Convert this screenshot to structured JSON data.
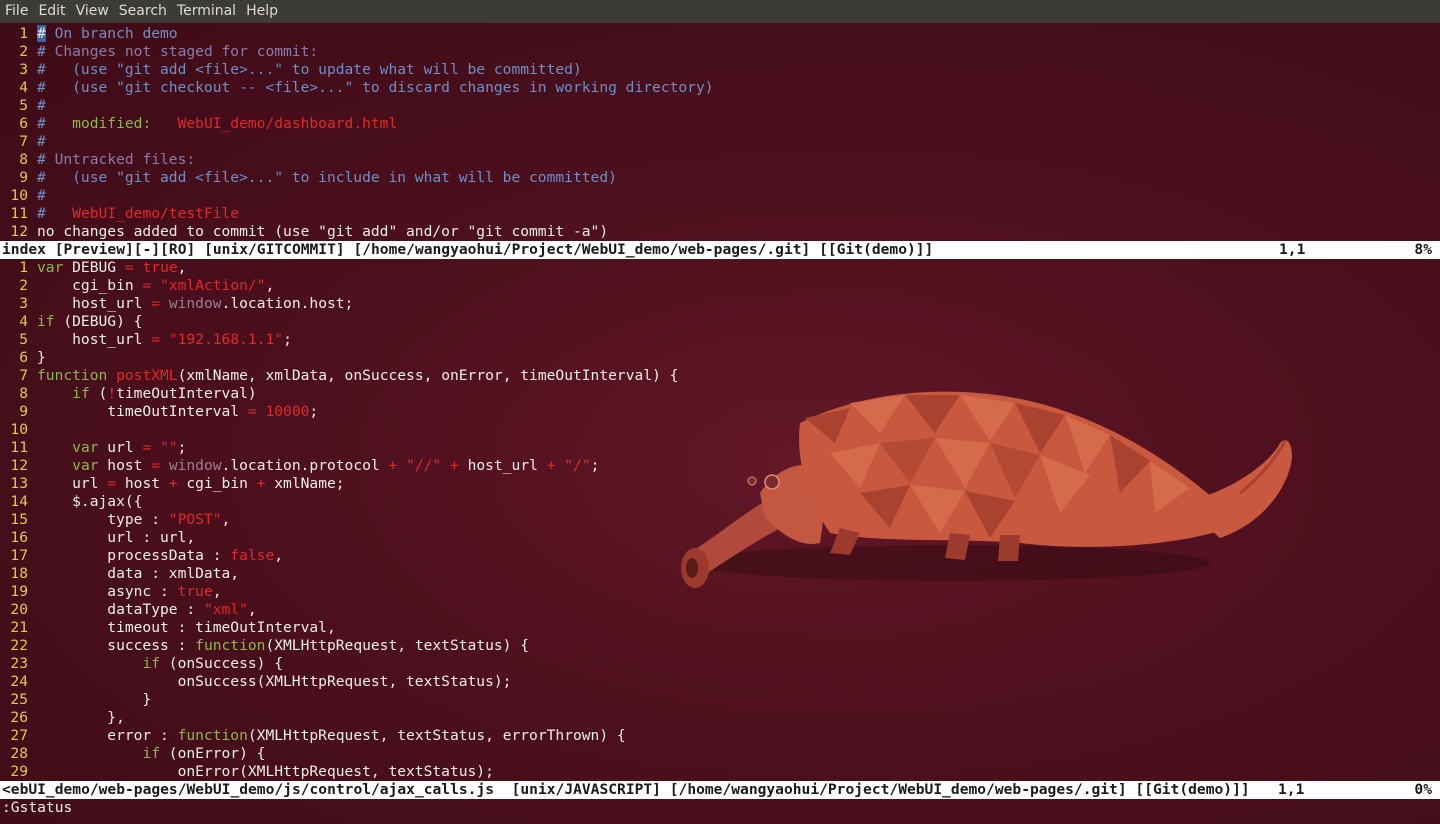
{
  "menubar": {
    "items": [
      "File",
      "Edit",
      "View",
      "Search",
      "Terminal",
      "Help"
    ]
  },
  "top_pane": {
    "lines": [
      {
        "n": "1",
        "parts": [
          [
            "cursor",
            "#"
          ],
          [
            "c-comment",
            " On branch demo"
          ]
        ]
      },
      {
        "n": "2",
        "parts": [
          [
            "c-comment",
            "# "
          ],
          [
            "c-header",
            "Changes not staged for commit:"
          ]
        ]
      },
      {
        "n": "3",
        "parts": [
          [
            "c-comment",
            "#   (use \"git add <file>...\" to update what will be committed)"
          ]
        ]
      },
      {
        "n": "4",
        "parts": [
          [
            "c-comment",
            "#   (use \"git checkout -- <file>...\" to discard changes in working directory)"
          ]
        ]
      },
      {
        "n": "5",
        "parts": [
          [
            "c-comment",
            "#"
          ]
        ]
      },
      {
        "n": "6",
        "parts": [
          [
            "c-comment",
            "#   "
          ],
          [
            "c-mod",
            "modified:"
          ],
          [
            "c-comment",
            "   "
          ],
          [
            "c-file",
            "WebUI_demo/dashboard.html"
          ]
        ]
      },
      {
        "n": "7",
        "parts": [
          [
            "c-comment",
            "#"
          ]
        ]
      },
      {
        "n": "8",
        "parts": [
          [
            "c-comment",
            "# "
          ],
          [
            "c-header",
            "Untracked files:"
          ]
        ]
      },
      {
        "n": "9",
        "parts": [
          [
            "c-comment",
            "#   (use \"git add <file>...\" to include in what will be committed)"
          ]
        ]
      },
      {
        "n": "10",
        "parts": [
          [
            "c-comment",
            "#"
          ]
        ]
      },
      {
        "n": "11",
        "parts": [
          [
            "c-comment",
            "#   "
          ],
          [
            "c-file",
            "WebUI_demo/testFile"
          ]
        ]
      },
      {
        "n": "12",
        "parts": [
          [
            "code",
            "no changes added to commit (use \"git add\" and/or \"git commit -a\")"
          ]
        ]
      }
    ],
    "status": {
      "left": "index [Preview][-][RO] [unix/GITCOMMIT] [/home/wangyaohui/Project/WebUI_demo/web-pages/.git] [[Git(demo)]]",
      "pos": "1,1",
      "pct": "8%"
    }
  },
  "bottom_pane": {
    "lines": [
      {
        "n": "1",
        "parts": [
          [
            "c-kw",
            "var"
          ],
          [
            "code",
            " DEBUG "
          ],
          [
            "c-op",
            "="
          ],
          [
            "code",
            " "
          ],
          [
            "c-str",
            "true"
          ],
          [
            "code",
            ","
          ]
        ]
      },
      {
        "n": "2",
        "parts": [
          [
            "code",
            "    cgi_bin "
          ],
          [
            "c-op",
            "="
          ],
          [
            "code",
            " "
          ],
          [
            "c-str",
            "\"xmlAction/\""
          ],
          [
            "code",
            ","
          ]
        ]
      },
      {
        "n": "3",
        "parts": [
          [
            "code",
            "    host_url "
          ],
          [
            "c-op",
            "="
          ],
          [
            "code",
            " "
          ],
          [
            "c-win",
            "window"
          ],
          [
            "code",
            ".location.host;"
          ]
        ]
      },
      {
        "n": "4",
        "parts": [
          [
            "c-kw",
            "if"
          ],
          [
            "code",
            " (DEBUG) {"
          ]
        ]
      },
      {
        "n": "5",
        "parts": [
          [
            "code",
            "    host_url "
          ],
          [
            "c-op",
            "="
          ],
          [
            "code",
            " "
          ],
          [
            "c-str",
            "\"192.168.1.1\""
          ],
          [
            "code",
            ";"
          ]
        ]
      },
      {
        "n": "6",
        "parts": [
          [
            "code",
            "}"
          ]
        ]
      },
      {
        "n": "7",
        "parts": [
          [
            "c-kw",
            "function"
          ],
          [
            "code",
            " "
          ],
          [
            "c-fn",
            "postXML"
          ],
          [
            "code",
            "(xmlName, xmlData, onSuccess, onError, timeOutInterval) {"
          ]
        ]
      },
      {
        "n": "8",
        "parts": [
          [
            "code",
            "    "
          ],
          [
            "c-kw",
            "if"
          ],
          [
            "code",
            " ("
          ],
          [
            "c-op",
            "!"
          ],
          [
            "code",
            "timeOutInterval)"
          ]
        ]
      },
      {
        "n": "9",
        "parts": [
          [
            "code",
            "        timeOutInterval "
          ],
          [
            "c-op",
            "="
          ],
          [
            "code",
            " "
          ],
          [
            "c-str",
            "10000"
          ],
          [
            "code",
            ";"
          ]
        ]
      },
      {
        "n": "10",
        "parts": [
          [
            "code",
            ""
          ]
        ]
      },
      {
        "n": "11",
        "parts": [
          [
            "code",
            "    "
          ],
          [
            "c-kw",
            "var"
          ],
          [
            "code",
            " url "
          ],
          [
            "c-op",
            "="
          ],
          [
            "code",
            " "
          ],
          [
            "c-str",
            "\"\""
          ],
          [
            "code",
            ";"
          ]
        ]
      },
      {
        "n": "12",
        "parts": [
          [
            "code",
            "    "
          ],
          [
            "c-kw",
            "var"
          ],
          [
            "code",
            " host "
          ],
          [
            "c-op",
            "="
          ],
          [
            "code",
            " "
          ],
          [
            "c-win",
            "window"
          ],
          [
            "code",
            ".location.protocol "
          ],
          [
            "c-op",
            "+"
          ],
          [
            "code",
            " "
          ],
          [
            "c-str",
            "\"//\""
          ],
          [
            "code",
            " "
          ],
          [
            "c-op",
            "+"
          ],
          [
            "code",
            " host_url "
          ],
          [
            "c-op",
            "+"
          ],
          [
            "code",
            " "
          ],
          [
            "c-str",
            "\"/\""
          ],
          [
            "code",
            ";"
          ]
        ]
      },
      {
        "n": "13",
        "parts": [
          [
            "code",
            "    url "
          ],
          [
            "c-op",
            "="
          ],
          [
            "code",
            " host "
          ],
          [
            "c-op",
            "+"
          ],
          [
            "code",
            " cgi_bin "
          ],
          [
            "c-op",
            "+"
          ],
          [
            "code",
            " xmlName;"
          ]
        ]
      },
      {
        "n": "14",
        "parts": [
          [
            "code",
            "    $.ajax({"
          ]
        ]
      },
      {
        "n": "15",
        "parts": [
          [
            "code",
            "        type : "
          ],
          [
            "c-str",
            "\"POST\""
          ],
          [
            "code",
            ","
          ]
        ]
      },
      {
        "n": "16",
        "parts": [
          [
            "code",
            "        url : url,"
          ]
        ]
      },
      {
        "n": "17",
        "parts": [
          [
            "code",
            "        processData : "
          ],
          [
            "c-str",
            "false"
          ],
          [
            "code",
            ","
          ]
        ]
      },
      {
        "n": "18",
        "parts": [
          [
            "code",
            "        data : xmlData,"
          ]
        ]
      },
      {
        "n": "19",
        "parts": [
          [
            "code",
            "        async : "
          ],
          [
            "c-str",
            "true"
          ],
          [
            "code",
            ","
          ]
        ]
      },
      {
        "n": "20",
        "parts": [
          [
            "code",
            "        dataType : "
          ],
          [
            "c-str",
            "\"xml\""
          ],
          [
            "code",
            ","
          ]
        ]
      },
      {
        "n": "21",
        "parts": [
          [
            "code",
            "        timeout : timeOutInterval,"
          ]
        ]
      },
      {
        "n": "22",
        "parts": [
          [
            "code",
            "        success : "
          ],
          [
            "c-kw",
            "function"
          ],
          [
            "code",
            "(XMLHttpRequest, textStatus) {"
          ]
        ]
      },
      {
        "n": "23",
        "parts": [
          [
            "code",
            "            "
          ],
          [
            "c-kw",
            "if"
          ],
          [
            "code",
            " (onSuccess) {"
          ]
        ]
      },
      {
        "n": "24",
        "parts": [
          [
            "code",
            "                onSuccess(XMLHttpRequest, textStatus);"
          ]
        ]
      },
      {
        "n": "25",
        "parts": [
          [
            "code",
            "            }"
          ]
        ]
      },
      {
        "n": "26",
        "parts": [
          [
            "code",
            "        },"
          ]
        ]
      },
      {
        "n": "27",
        "parts": [
          [
            "code",
            "        error : "
          ],
          [
            "c-kw",
            "function"
          ],
          [
            "code",
            "(XMLHttpRequest, textStatus, errorThrown) {"
          ]
        ]
      },
      {
        "n": "28",
        "parts": [
          [
            "code",
            "            "
          ],
          [
            "c-kw",
            "if"
          ],
          [
            "code",
            " (onError) {"
          ]
        ]
      },
      {
        "n": "29",
        "parts": [
          [
            "code",
            "                onError(XMLHttpRequest, textStatus);"
          ]
        ]
      }
    ],
    "status": {
      "left": "<ebUI_demo/web-pages/WebUI_demo/js/control/ajax_calls.js  [unix/JAVASCRIPT] [/home/wangyaohui/Project/WebUI_demo/web-pages/.git] [[Git(demo)]]",
      "pos": "1,1",
      "pct": "0%"
    }
  },
  "command_line": ":Gstatus",
  "colors": {
    "background": "#4a0f1c",
    "menubar": "#3c3b37",
    "line_number": "#e6c84a",
    "comment": "#6f8fc8",
    "keyword": "#8ab84a",
    "string": "#e0292a",
    "statusline": "#ffffff"
  }
}
